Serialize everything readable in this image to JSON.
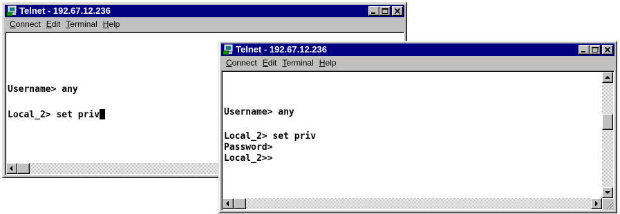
{
  "windows": [
    {
      "title": "Telnet - 192.67.12.236",
      "menu": [
        "Connect",
        "Edit",
        "Terminal",
        "Help"
      ],
      "menu_accel": [
        "C",
        "E",
        "T",
        "H"
      ],
      "lines": [
        "Username> any",
        "Local_2> set priv"
      ]
    },
    {
      "title": "Telnet - 192.67.12.236",
      "menu": [
        "Connect",
        "Edit",
        "Terminal",
        "Help"
      ],
      "menu_accel": [
        "C",
        "E",
        "T",
        "H"
      ],
      "lines": [
        "Username> any",
        "Local_2> set priv",
        "Password>",
        "Local_2>>"
      ]
    }
  ],
  "colors": {
    "titlebar": "#000080",
    "chrome": "#c0c0c0",
    "terminal_bg": "#ffffff",
    "text": "#000000"
  },
  "icons": [
    "telnet-app-icon",
    "minimize-icon",
    "maximize-icon",
    "close-icon",
    "arrow-up-icon",
    "arrow-down-icon",
    "arrow-left-icon",
    "arrow-right-icon"
  ]
}
